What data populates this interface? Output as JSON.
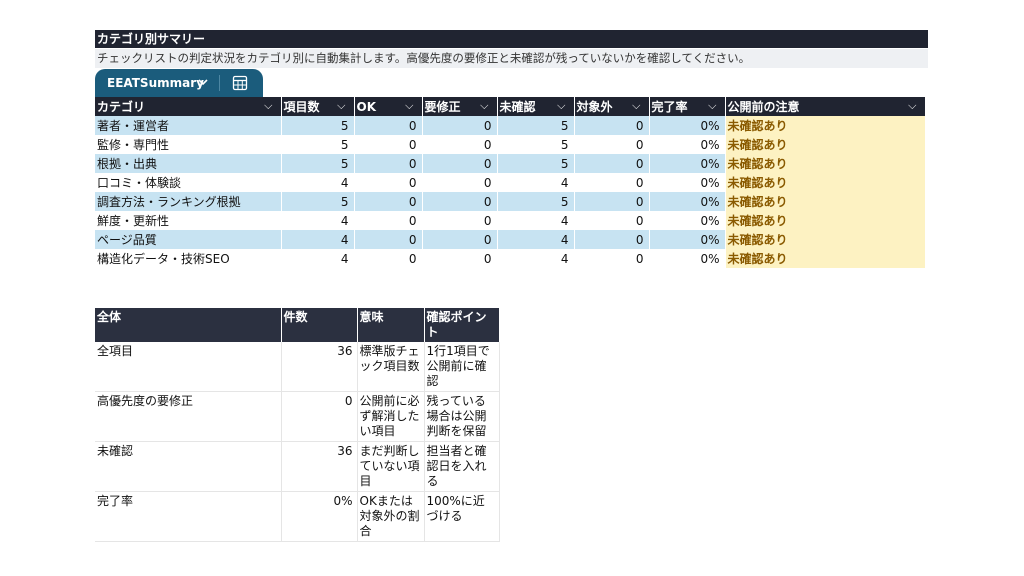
{
  "header": {
    "title": "カテゴリ別サマリー",
    "subtitle": "チェックリストの判定状況をカテゴリ別に自動集計します。高優先度の要修正と未確認が残っていないかを確認してください。"
  },
  "tab": {
    "label": "EEATSummary",
    "chevron_icon": "chevron-down-icon",
    "grid_icon": "table-grid-icon"
  },
  "summary_table": {
    "headers": [
      "カテゴリ",
      "項目数",
      "OK",
      "要修正",
      "未確認",
      "対象外",
      "完了率",
      "公開前の注意"
    ],
    "rows": [
      [
        "著者・運営者",
        "5",
        "0",
        "0",
        "5",
        "0",
        "0%",
        "未確認あり"
      ],
      [
        "監修・専門性",
        "5",
        "0",
        "0",
        "5",
        "0",
        "0%",
        "未確認あり"
      ],
      [
        "根拠・出典",
        "5",
        "0",
        "0",
        "5",
        "0",
        "0%",
        "未確認あり"
      ],
      [
        "口コミ・体験談",
        "4",
        "0",
        "0",
        "4",
        "0",
        "0%",
        "未確認あり"
      ],
      [
        "調査方法・ランキング根拠",
        "5",
        "0",
        "0",
        "5",
        "0",
        "0%",
        "未確認あり"
      ],
      [
        "鮮度・更新性",
        "4",
        "0",
        "0",
        "4",
        "0",
        "0%",
        "未確認あり"
      ],
      [
        "ページ品質",
        "4",
        "0",
        "0",
        "4",
        "0",
        "0%",
        "未確認あり"
      ],
      [
        "構造化データ・技術SEO",
        "4",
        "0",
        "0",
        "4",
        "0",
        "0%",
        "未確認あり"
      ]
    ]
  },
  "overall_table": {
    "headers": [
      "全体",
      "件数",
      "意味",
      "確認ポイント"
    ],
    "rows": [
      [
        "全項目",
        "36",
        "標準版チェック項目数",
        "1行1項目で公開前に確認"
      ],
      [
        "高優先度の要修正",
        "0",
        "公開前に必ず解消したい項目",
        "残っている場合は公開判断を保留"
      ],
      [
        "未確認",
        "36",
        "まだ判断していない項目",
        "担当者と確認日を入れる"
      ],
      [
        "完了率",
        "0%",
        "OKまたは対象外の割合",
        "100%に近づける"
      ]
    ]
  },
  "colors": {
    "header_dark": "#202431",
    "tab": "#1b5c7c",
    "band": "#c7e3f2",
    "note_bg": "#fdf2c2",
    "note_text": "#8a5a00"
  }
}
